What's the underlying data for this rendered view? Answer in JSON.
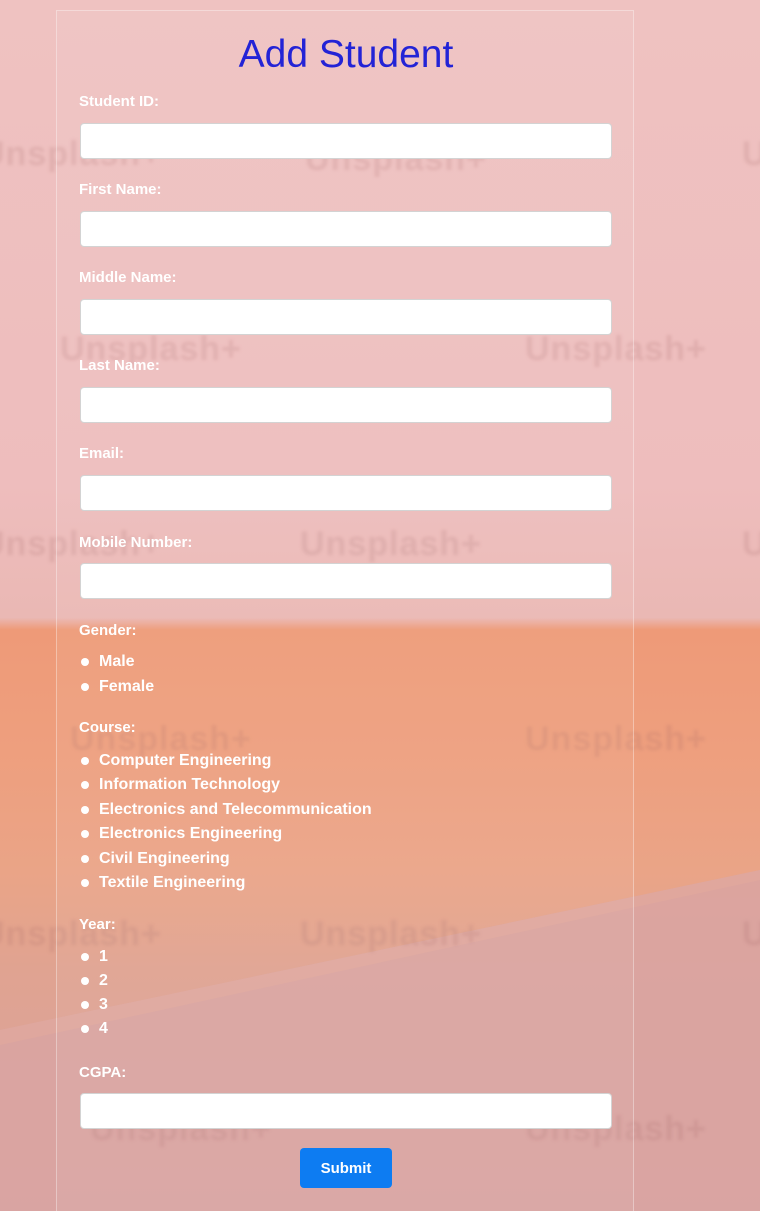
{
  "form": {
    "title": "Add Student",
    "fields": [
      {
        "label": "Student ID:",
        "value": ""
      },
      {
        "label": "First Name:",
        "value": ""
      },
      {
        "label": "Middle Name:",
        "value": ""
      },
      {
        "label": "Last Name:",
        "value": ""
      },
      {
        "label": "Email:",
        "value": ""
      },
      {
        "label": "Mobile Number:",
        "value": ""
      }
    ],
    "gender": {
      "label": "Gender:",
      "options": [
        "Male",
        "Female"
      ]
    },
    "course": {
      "label": "Course:",
      "options": [
        "Computer Engineering",
        "Information Technology",
        "Electronics and Telecommunication",
        "Electronics Engineering",
        "Civil Engineering",
        "Textile Engineering"
      ]
    },
    "year": {
      "label": "Year:",
      "options": [
        "1",
        "2",
        "3",
        "4"
      ]
    },
    "cgpa": {
      "label": "CGPA:",
      "value": ""
    },
    "submit_label": "Submit"
  },
  "watermark": {
    "text": "Unsplash+"
  },
  "colors": {
    "title": "#2323d6",
    "submit": "#0d7cf2",
    "label": "#ffffff"
  }
}
